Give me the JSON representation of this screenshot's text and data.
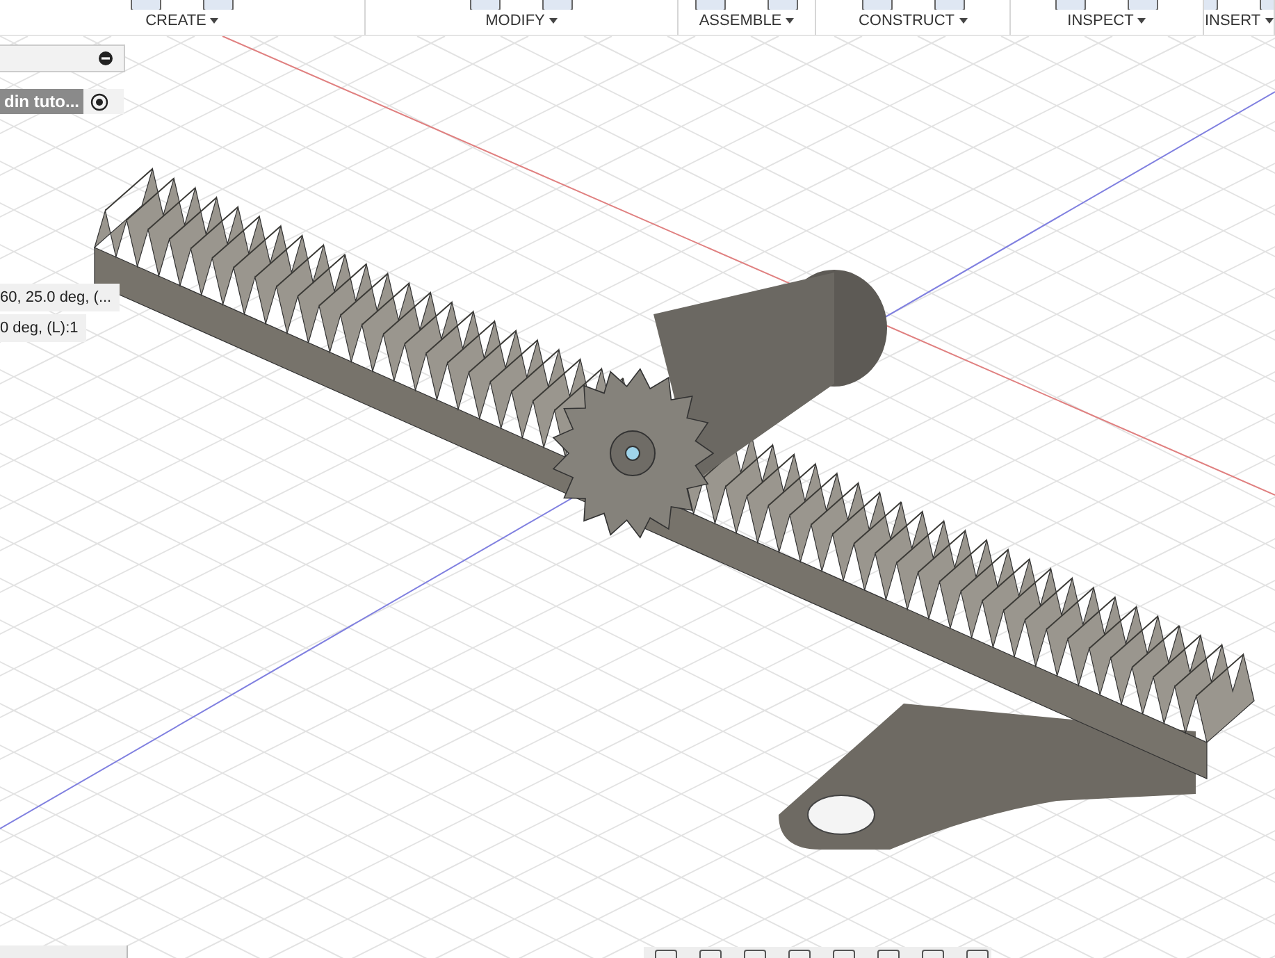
{
  "toolbar": {
    "groups": [
      {
        "label": "CREATE"
      },
      {
        "label": "MODIFY"
      },
      {
        "label": "ASSEMBLE"
      },
      {
        "label": "CONSTRUCT"
      },
      {
        "label": "INSPECT"
      },
      {
        "label": "INSERT"
      }
    ]
  },
  "browser": {
    "node_label": "din tuto..."
  },
  "dimension_labels": [
    "60, 25.0 deg, (...",
    "0 deg, (L):1"
  ]
}
